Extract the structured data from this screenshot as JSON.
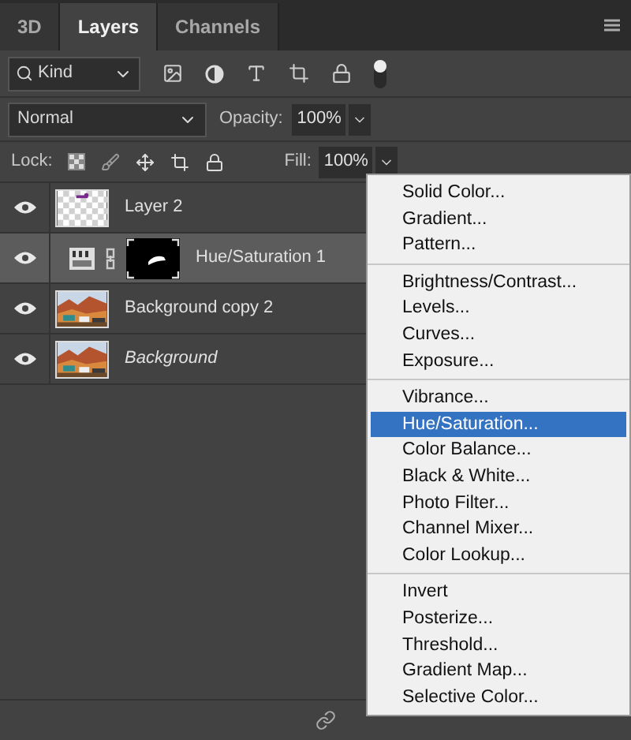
{
  "tabs": [
    {
      "label": "3D",
      "selected": false
    },
    {
      "label": "Layers",
      "selected": true
    },
    {
      "label": "Channels",
      "selected": false
    }
  ],
  "filter": {
    "value": "Kind"
  },
  "blend_mode": {
    "value": "Normal"
  },
  "opacity": {
    "label": "Opacity:",
    "value": "100%"
  },
  "lock": {
    "label": "Lock:"
  },
  "fill": {
    "label": "Fill:",
    "value": "100%"
  },
  "layers": [
    {
      "name": "Layer 2",
      "kind": "pixel",
      "visible": true,
      "selected": false
    },
    {
      "name": "Hue/Saturation 1",
      "kind": "adjustment",
      "visible": true,
      "selected": true
    },
    {
      "name": "Background copy 2",
      "visible": true,
      "selected": false
    },
    {
      "name": "Background",
      "kind": "background",
      "visible": true,
      "selected": false
    }
  ],
  "menu": [
    [
      {
        "label": "Solid Color...",
        "selected": false
      },
      {
        "label": "Gradient...",
        "selected": false
      },
      {
        "label": "Pattern...",
        "selected": false
      }
    ],
    [
      {
        "label": "Brightness/Contrast...",
        "selected": false
      },
      {
        "label": "Levels...",
        "selected": false
      },
      {
        "label": "Curves...",
        "selected": false
      },
      {
        "label": "Exposure...",
        "selected": false
      }
    ],
    [
      {
        "label": "Vibrance...",
        "selected": false
      },
      {
        "label": "Hue/Saturation...",
        "selected": true
      },
      {
        "label": "Color Balance...",
        "selected": false
      },
      {
        "label": "Black & White...",
        "selected": false
      },
      {
        "label": "Photo Filter...",
        "selected": false
      },
      {
        "label": "Channel Mixer...",
        "selected": false
      },
      {
        "label": "Color Lookup...",
        "selected": false
      }
    ],
    [
      {
        "label": "Invert",
        "selected": false
      },
      {
        "label": "Posterize...",
        "selected": false
      },
      {
        "label": "Threshold...",
        "selected": false
      },
      {
        "label": "Gradient Map...",
        "selected": false
      },
      {
        "label": "Selective Color...",
        "selected": false
      }
    ]
  ]
}
